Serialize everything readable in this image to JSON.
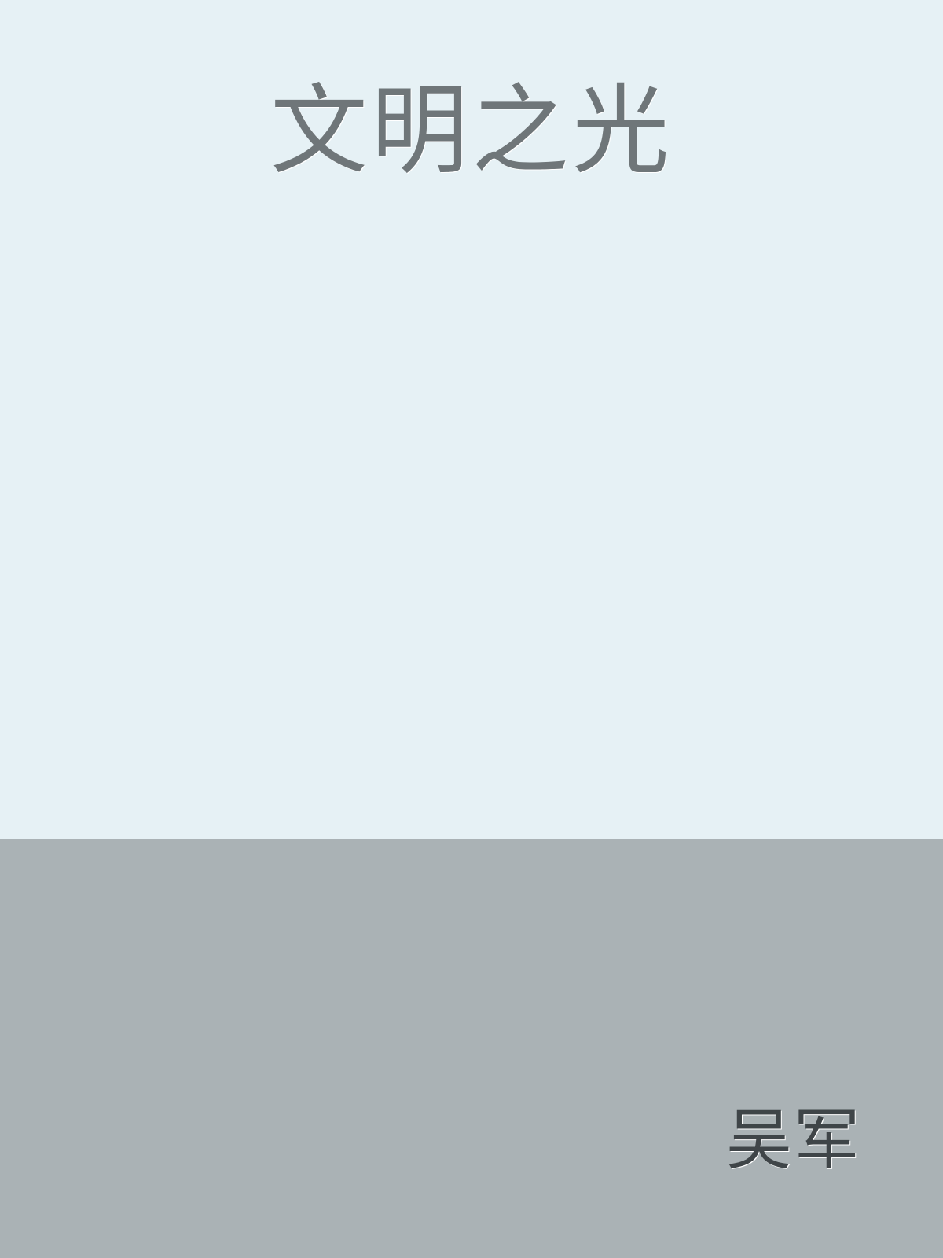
{
  "book": {
    "title": "文明之光",
    "author": "吴军"
  },
  "colors": {
    "top_background": "#e6f1f5",
    "bottom_background": "#aab2b5",
    "title_color": "#6f7679",
    "author_color": "#3f4548"
  }
}
